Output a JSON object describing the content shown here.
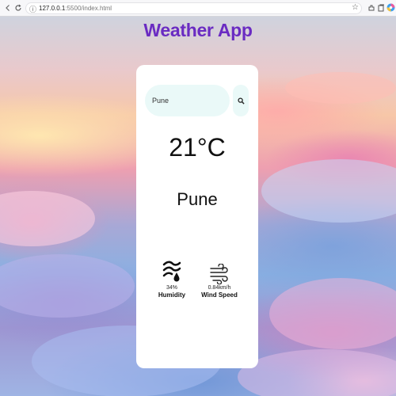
{
  "browser": {
    "url_host": "127.0.0.1",
    "url_rest": ":5500/index.html",
    "icons": [
      "back-icon",
      "refresh-icon",
      "info-icon",
      "favorites-icon",
      "extensions-icon",
      "collections-icon",
      "copilot-icon"
    ]
  },
  "app": {
    "title": "Weather App",
    "title_color": "#6a2bc2"
  },
  "search": {
    "value": "Pune",
    "button_icon": "search-icon"
  },
  "weather": {
    "temperature": "21°C",
    "city": "Pune"
  },
  "stats": {
    "humidity": {
      "value": "34%",
      "label": "Humidity",
      "icon": "humidity-icon"
    },
    "wind": {
      "value": "0.84km/h",
      "label": "Wind Speed",
      "icon": "wind-icon"
    }
  }
}
